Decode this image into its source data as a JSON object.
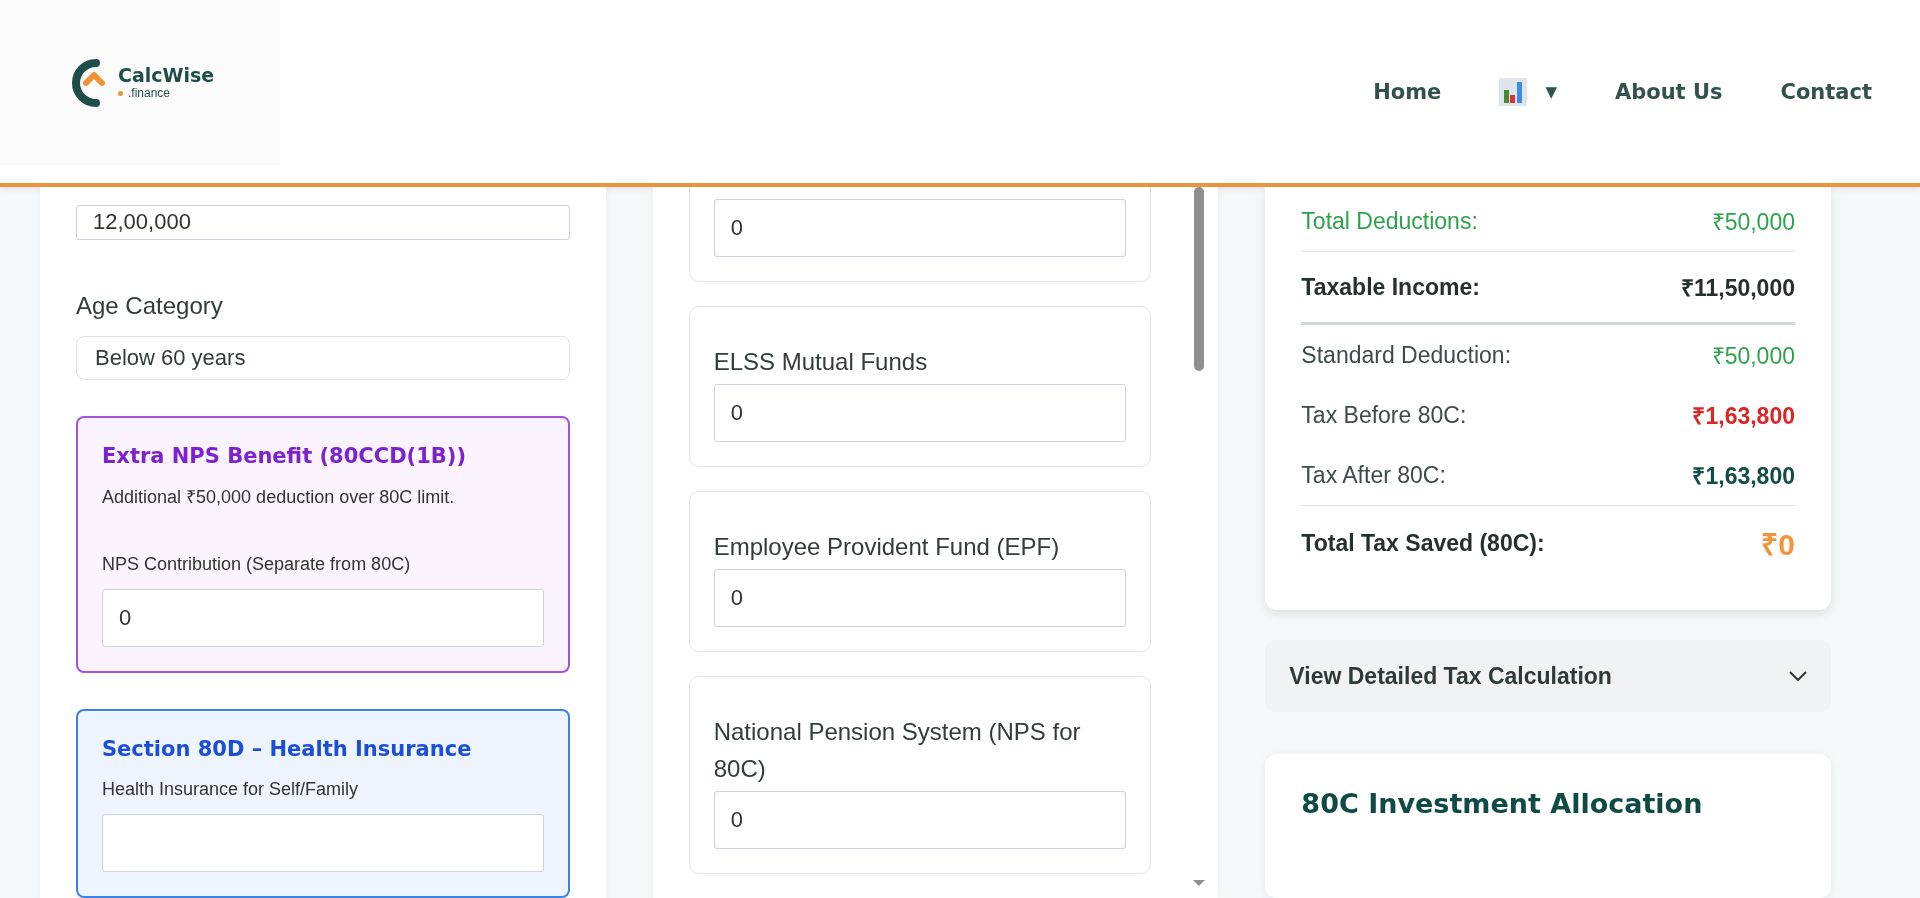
{
  "header": {
    "logo": {
      "name": "CalcWise",
      "suffix": ".finance"
    },
    "nav": [
      {
        "kind": "link",
        "label": "Home"
      },
      {
        "kind": "menu",
        "label": "▼"
      },
      {
        "kind": "link",
        "label": "About Us"
      },
      {
        "kind": "link",
        "label": "Contact"
      }
    ]
  },
  "left_panel": {
    "income_field": {
      "value": "12,00,000"
    },
    "age_category": {
      "label": "Age Category",
      "value": "Below 60 years"
    },
    "nps_box": {
      "title": "Extra NPS Benefit (80CCD(1B))",
      "description": "Additional ₹50,000 deduction over 80C limit.",
      "field_label": "NPS Contribution (Separate from 80C)",
      "value": "0"
    },
    "health_box": {
      "title": "Section 80D – Health Insurance",
      "field_label": "Health Insurance for Self/Family"
    }
  },
  "investments": [
    {
      "value": "0"
    },
    {
      "label": "ELSS Mutual Funds",
      "value": "0"
    },
    {
      "label": "Employee Provident Fund (EPF)",
      "value": "0"
    },
    {
      "label": "National Pension System (NPS for 80C)",
      "value": "0"
    }
  ],
  "summary": [
    {
      "label": "Total Deductions:",
      "value": "₹50,000",
      "kind": "deduction"
    },
    {
      "label": "Taxable Income:",
      "value": "₹11,50,000",
      "kind": "strong"
    },
    {
      "label": "Standard Deduction:",
      "value": "₹50,000",
      "kind": "positive"
    },
    {
      "label": "Tax Before 80C:",
      "value": "₹1,63,800",
      "kind": "negative"
    },
    {
      "label": "Tax After 80C:",
      "value": "₹1,63,800",
      "kind": "result"
    },
    {
      "label": "Total Tax Saved (80C):",
      "value": "₹0",
      "kind": "saved"
    }
  ],
  "details": {
    "title": "View Detailed Tax Calculation",
    "expanded": false
  },
  "allocation": {
    "title": "80C Investment Allocation"
  }
}
